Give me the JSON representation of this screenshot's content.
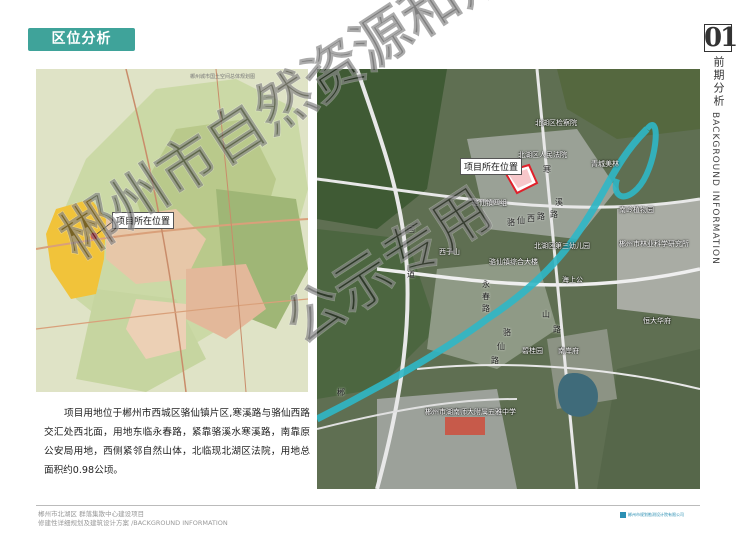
{
  "header": {
    "title": "区位分析"
  },
  "side": {
    "page_number": "01",
    "cn_label": "前期分析",
    "en_label": "BACKGROUND INFORMATION"
  },
  "left_map": {
    "header_text": "郴州城市国土空间总体规划图",
    "callout": "项目所在位置"
  },
  "right_map": {
    "callout": "项目所在位置",
    "places": [
      "北湖区检察院",
      "北湖区人民法院",
      "青城美林",
      "南岭植物园",
      "骆仙镇四组",
      "北湖区第三幼儿园",
      "郴州市林业科学研究所",
      "西子山",
      "骆仙镇综合大楼",
      "海上公",
      "恒大华府",
      "碧桂园",
      "南岸府",
      "郴州市湖南师大附属五雅中学"
    ],
    "road_chars": [
      "寒",
      "溪",
      "路",
      "骆",
      "仙",
      "西",
      "路",
      "国",
      "道",
      "永",
      "春",
      "路",
      "山",
      "路",
      "骆",
      "仙",
      "路",
      "郴"
    ]
  },
  "description": "项目用地位于郴州市西城区骆仙镇片区,寒溪路与骆仙西路交汇处西北面，用地东临永春路，紧靠骆溪水寒溪路，南靠原公安局用地，西侧紧邻自然山体，北临现北湖区法院，用地总面积约0.98公顷。",
  "footer": {
    "line1": "郴州市北湖区 群落集散中心建设项目",
    "line2": "修建性详细规划及建筑设计方案 /BACKGROUND INFORMATION",
    "logo_text": "郴州市规划勘测设计院有限公司"
  },
  "watermark": {
    "line1": "郴州市自然资源和规划局",
    "line2": "公示专用"
  },
  "colors": {
    "accent": "#3fa39a",
    "site_red": "#e0202a",
    "callout_border": "#555555",
    "yellow_area": "#f1c33a",
    "river": "#2fb7c6"
  }
}
